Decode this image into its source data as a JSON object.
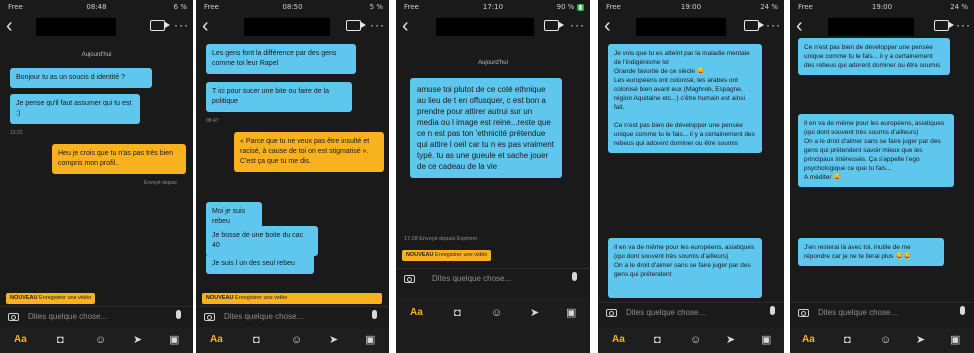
{
  "phones": [
    {
      "status": {
        "carrier": "Free",
        "time": "08:48",
        "battery": "6 %"
      },
      "date_label": "Aujourd'hui",
      "messages": [
        "Bonjour tu as un soucis d identité ?",
        "Je pense qu'il faut assumer qui tu est :)",
        "Heu je crois que tu n'as pas très bien compris mon profil.."
      ],
      "seen_label": "Envoyé depuis",
      "placeholder": "Dites quelque chose...",
      "nouveau": "NOUVEAU",
      "nouveau_text": "Enregistrer une vidéo",
      "aa": "Aa"
    },
    {
      "status": {
        "carrier": "Free",
        "time": "08:50",
        "battery": "5 %"
      },
      "messages": [
        "Les gens font la différence par des gens comme toi leur Rapel",
        "T ici pour sucer une bite ou faire de la politique",
        "« Parce que tu ne veux pas être insulté et racisé, à cause de toi on est stigmatisé ». C'est ça que tu me dis.",
        "Moi je suis rebeu",
        "Je bosse de une boite du cac 40",
        "Je suis l un des seul rebeu"
      ],
      "placeholder": "Dites quelque chose...",
      "nouveau": "NOUVEAU",
      "nouveau_text": "Enregistrer une vidéo",
      "aa": "Aa"
    },
    {
      "status": {
        "carrier": "Free",
        "time": "17:10",
        "battery": "90 %"
      },
      "date_label": "Aujourd'hui",
      "messages": [
        "amuse toi plutot de ce coté ethnique au lieu de t en offusquer, c est bon a prendre pour attirer autrui sur un media ou l image est reine...reste que ce n est pas ton 'ethnicité prétendue qui attire l oeil  car tu n es pas vraiment typé. tu as une gueule et sache jouer de ce cadeau de la vie"
      ],
      "sent_label": "17:28 Envoyé depuis Explorer",
      "placeholder": "Dites quelque chose...",
      "nouveau": "NOUVEAU",
      "nouveau_text": "Enregistrer une vidéo",
      "aa": "Aa"
    },
    {
      "status": {
        "carrier": "Free",
        "time": "19:00",
        "battery": "24 %"
      },
      "messages": [
        "Je vois que tu es atteint par la maladie mentale de l'indigénisme lol\nGrande favorite de ce siècle 😅\nLes européens ont colonisé, les arabes ont colonisé bien avant eux (Maghreb, Espagne, région Aquitaine etc...) c'être humain est ainsi fait.\n\nCe n'est pas bien de développer une pensée unique comme tu le fais... il y a certainement des rebeus qui adorent dominer ou être soumis",
        "Il en va de même pour les européens, asiatiques (qui dont souvent très soumis d'ailleurs)\nOn a le droit d'aimer sans se faire juger par des gens qui prétendent"
      ],
      "placeholder": "Dites quelque chose...",
      "aa": "Aa"
    },
    {
      "status": {
        "carrier": "Free",
        "time": "19:00",
        "battery": "24 %"
      },
      "messages": [
        "Ce n'est pas bien de développer une pensée unique comme tu le fais... il y a certainement des rebeus qui adorent dominer ou être soumis",
        "Il en va de même pour les européens, asiatiques (qui dont souvent très soumis d'ailleurs)\nOn a le droit d'aimer sans se faire juger par des gens qui prétendent savoir mieux que les principaux intéressés. Ça s'appelle l'ego psychologique ce que tu fais...\nA méditer 😅",
        "J'en resterai là avec toi, inutile de me répondre car je ne te lierai plus 😂😂"
      ],
      "placeholder": "Dites quelque chose...",
      "aa": "Aa"
    }
  ],
  "icons": [
    "back-arrow-icon",
    "video-call-icon",
    "more-icon",
    "camera-icon",
    "microphone-icon",
    "photo-icon",
    "emoji-icon",
    "location-icon",
    "send-icon"
  ],
  "colors": {
    "incoming": "#5fc6ee",
    "outgoing": "#f8b21d",
    "background": "#1a1a1a"
  }
}
